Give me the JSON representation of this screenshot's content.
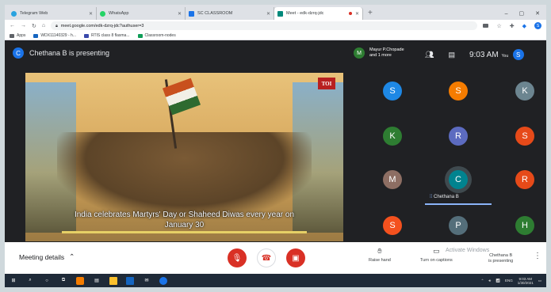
{
  "browser": {
    "tabs": [
      {
        "label": "Telegram Web",
        "color": "#2aa3df",
        "active": false
      },
      {
        "label": "WhatsApp",
        "color": "#25d366",
        "active": false
      },
      {
        "label": "SC CLASSROOM",
        "color": "#1a73e8",
        "active": false
      },
      {
        "label": "Meet - edk-dzrq-jdc",
        "color": "#00897b",
        "active": true
      }
    ],
    "new_tab": "+",
    "url": "meet.google.com/edk-dzrq-jdc?authuser=3",
    "bookmarks": [
      {
        "label": "Apps",
        "color": "#5f6368"
      },
      {
        "label": "WDX11140329 - h...",
        "color": "#1565c0"
      },
      {
        "label": "RTIS class 8 flasma...",
        "color": "#3949ab"
      },
      {
        "label": "Classroom-nodes",
        "color": "#0f9d58"
      }
    ],
    "profile_initial": "S"
  },
  "meet": {
    "presenter_initial": "C",
    "presenter_text": "Chethana B is presenting",
    "presentation": {
      "caption": "India celebrates Martyrs' Day or Shaheed Diwas every year on January 30",
      "logo": "TOI"
    },
    "pinned": {
      "initial": "M",
      "name_line1": "Mayur P.Chopade",
      "name_line2": "and 1 more"
    },
    "time": "9:03 AM",
    "you_label": "You",
    "you_initial": "S",
    "participants": [
      {
        "initial": "S",
        "color": "#1e88e5"
      },
      {
        "initial": "S",
        "color": "#f57c00"
      },
      {
        "initial": "K",
        "color": "#6c8590"
      },
      {
        "initial": "K",
        "color": "#2e7d32"
      },
      {
        "initial": "R",
        "color": "#5c6bc0"
      },
      {
        "initial": "S",
        "color": "#e64a19"
      },
      {
        "initial": "M",
        "color": "#8d6e63"
      },
      {
        "initial": "C",
        "color": "#00838f"
      },
      {
        "initial": "R",
        "color": "#e64a19"
      },
      {
        "initial": "S",
        "color": "#f4511e"
      },
      {
        "initial": "P",
        "color": "#546e7a"
      },
      {
        "initial": "H",
        "color": "#2e7d32"
      }
    ],
    "speaking_name": "Chethana B",
    "controls": {
      "meeting_details": "Meeting details",
      "raise_hand": "Raise hand",
      "captions": "Turn on captions",
      "presenting_line1": "Chethana B",
      "presenting_line2": "is presenting",
      "watermark": "Activate Windows"
    }
  },
  "taskbar": {
    "lang": "ENG",
    "clock_time": "9:03 AM",
    "clock_date": "1/30/2021"
  }
}
